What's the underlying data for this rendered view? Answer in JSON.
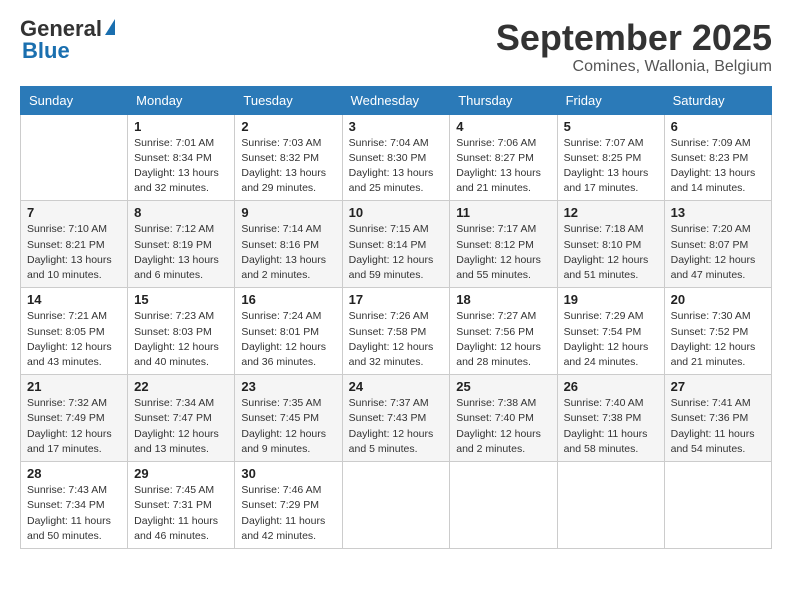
{
  "logo": {
    "general": "General",
    "blue": "Blue"
  },
  "header": {
    "month": "September 2025",
    "location": "Comines, Wallonia, Belgium"
  },
  "weekdays": [
    "Sunday",
    "Monday",
    "Tuesday",
    "Wednesday",
    "Thursday",
    "Friday",
    "Saturday"
  ],
  "weeks": [
    [
      {
        "day": "",
        "info": ""
      },
      {
        "day": "1",
        "info": "Sunrise: 7:01 AM\nSunset: 8:34 PM\nDaylight: 13 hours\nand 32 minutes."
      },
      {
        "day": "2",
        "info": "Sunrise: 7:03 AM\nSunset: 8:32 PM\nDaylight: 13 hours\nand 29 minutes."
      },
      {
        "day": "3",
        "info": "Sunrise: 7:04 AM\nSunset: 8:30 PM\nDaylight: 13 hours\nand 25 minutes."
      },
      {
        "day": "4",
        "info": "Sunrise: 7:06 AM\nSunset: 8:27 PM\nDaylight: 13 hours\nand 21 minutes."
      },
      {
        "day": "5",
        "info": "Sunrise: 7:07 AM\nSunset: 8:25 PM\nDaylight: 13 hours\nand 17 minutes."
      },
      {
        "day": "6",
        "info": "Sunrise: 7:09 AM\nSunset: 8:23 PM\nDaylight: 13 hours\nand 14 minutes."
      }
    ],
    [
      {
        "day": "7",
        "info": "Sunrise: 7:10 AM\nSunset: 8:21 PM\nDaylight: 13 hours\nand 10 minutes."
      },
      {
        "day": "8",
        "info": "Sunrise: 7:12 AM\nSunset: 8:19 PM\nDaylight: 13 hours\nand 6 minutes."
      },
      {
        "day": "9",
        "info": "Sunrise: 7:14 AM\nSunset: 8:16 PM\nDaylight: 13 hours\nand 2 minutes."
      },
      {
        "day": "10",
        "info": "Sunrise: 7:15 AM\nSunset: 8:14 PM\nDaylight: 12 hours\nand 59 minutes."
      },
      {
        "day": "11",
        "info": "Sunrise: 7:17 AM\nSunset: 8:12 PM\nDaylight: 12 hours\nand 55 minutes."
      },
      {
        "day": "12",
        "info": "Sunrise: 7:18 AM\nSunset: 8:10 PM\nDaylight: 12 hours\nand 51 minutes."
      },
      {
        "day": "13",
        "info": "Sunrise: 7:20 AM\nSunset: 8:07 PM\nDaylight: 12 hours\nand 47 minutes."
      }
    ],
    [
      {
        "day": "14",
        "info": "Sunrise: 7:21 AM\nSunset: 8:05 PM\nDaylight: 12 hours\nand 43 minutes."
      },
      {
        "day": "15",
        "info": "Sunrise: 7:23 AM\nSunset: 8:03 PM\nDaylight: 12 hours\nand 40 minutes."
      },
      {
        "day": "16",
        "info": "Sunrise: 7:24 AM\nSunset: 8:01 PM\nDaylight: 12 hours\nand 36 minutes."
      },
      {
        "day": "17",
        "info": "Sunrise: 7:26 AM\nSunset: 7:58 PM\nDaylight: 12 hours\nand 32 minutes."
      },
      {
        "day": "18",
        "info": "Sunrise: 7:27 AM\nSunset: 7:56 PM\nDaylight: 12 hours\nand 28 minutes."
      },
      {
        "day": "19",
        "info": "Sunrise: 7:29 AM\nSunset: 7:54 PM\nDaylight: 12 hours\nand 24 minutes."
      },
      {
        "day": "20",
        "info": "Sunrise: 7:30 AM\nSunset: 7:52 PM\nDaylight: 12 hours\nand 21 minutes."
      }
    ],
    [
      {
        "day": "21",
        "info": "Sunrise: 7:32 AM\nSunset: 7:49 PM\nDaylight: 12 hours\nand 17 minutes."
      },
      {
        "day": "22",
        "info": "Sunrise: 7:34 AM\nSunset: 7:47 PM\nDaylight: 12 hours\nand 13 minutes."
      },
      {
        "day": "23",
        "info": "Sunrise: 7:35 AM\nSunset: 7:45 PM\nDaylight: 12 hours\nand 9 minutes."
      },
      {
        "day": "24",
        "info": "Sunrise: 7:37 AM\nSunset: 7:43 PM\nDaylight: 12 hours\nand 5 minutes."
      },
      {
        "day": "25",
        "info": "Sunrise: 7:38 AM\nSunset: 7:40 PM\nDaylight: 12 hours\nand 2 minutes."
      },
      {
        "day": "26",
        "info": "Sunrise: 7:40 AM\nSunset: 7:38 PM\nDaylight: 11 hours\nand 58 minutes."
      },
      {
        "day": "27",
        "info": "Sunrise: 7:41 AM\nSunset: 7:36 PM\nDaylight: 11 hours\nand 54 minutes."
      }
    ],
    [
      {
        "day": "28",
        "info": "Sunrise: 7:43 AM\nSunset: 7:34 PM\nDaylight: 11 hours\nand 50 minutes."
      },
      {
        "day": "29",
        "info": "Sunrise: 7:45 AM\nSunset: 7:31 PM\nDaylight: 11 hours\nand 46 minutes."
      },
      {
        "day": "30",
        "info": "Sunrise: 7:46 AM\nSunset: 7:29 PM\nDaylight: 11 hours\nand 42 minutes."
      },
      {
        "day": "",
        "info": ""
      },
      {
        "day": "",
        "info": ""
      },
      {
        "day": "",
        "info": ""
      },
      {
        "day": "",
        "info": ""
      }
    ]
  ]
}
